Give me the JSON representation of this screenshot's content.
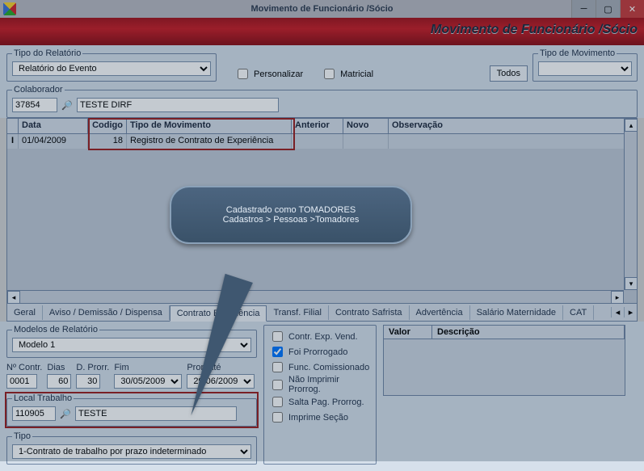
{
  "window": {
    "title": "Movimento de Funcionário /Sócio",
    "subtitle": "Movimento de Funcionário /Sócio"
  },
  "filters": {
    "tipo_relatorio_label": "Tipo do Relatório",
    "tipo_relatorio_value": "Relatório do Evento",
    "personalizar_label": "Personalizar",
    "matricial_label": "Matricial",
    "todos_label": "Todos",
    "tipo_movimento_label": "Tipo de Movimento",
    "tipo_movimento_value": ""
  },
  "colab": {
    "label": "Colaborador",
    "code": "37854",
    "name": "TESTE DIRF"
  },
  "grid": {
    "headers": {
      "data": "Data",
      "codigo": "Codigo",
      "tipomov": "Tipo de Movimento",
      "anterior": "Anterior",
      "novo": "Novo",
      "obs": "Observação"
    },
    "row0": {
      "data": "01/04/2009",
      "codigo": "18",
      "tipomov": "Registro de Contrato de Experiência",
      "anterior": "",
      "novo": "",
      "obs": ""
    }
  },
  "callout": {
    "line1": "Cadastrado  como TOMADORES",
    "line2": "Cadastros > Pessoas >Tomadores"
  },
  "tabs": {
    "geral": "Geral",
    "aviso": "Aviso / Demissão / Dispensa",
    "contrato": "Contrato Experiência",
    "transf": "Transf. Filial",
    "safrista": "Contrato Safrista",
    "advert": "Advertência",
    "salmat": "Salário Maternidade",
    "cat": "CAT"
  },
  "contrato": {
    "modelos_label": "Modelos de Relatório",
    "modelo_value": "Modelo 1",
    "n_contr_label": "Nº Contr.",
    "n_contr_value": "0001",
    "dias_label": "Dias",
    "dias_value": "60",
    "dprorr_label": "D. Prorr.",
    "dprorr_value": "30",
    "fim_label": "Fim",
    "fim_value": "30/05/2009",
    "prorate_label": "Pror. Até",
    "prorate_value": "29/06/2009",
    "local_label": "Local Trabalho",
    "local_code": "110905",
    "local_name": "TESTE",
    "tipo_label": "Tipo",
    "tipo_value": "1-Contrato de trabalho por prazo indeterminado"
  },
  "checks": {
    "c1": "Contr. Exp. Vend.",
    "c2": "Foi Prorrogado",
    "c3": "Func. Comissionado",
    "c4": "Não Imprimir Prorrog.",
    "c5": "Salta Pag. Prorrog.",
    "c6": "Imprime Seção"
  },
  "valgrid": {
    "valor": "Valor",
    "descricao": "Descrição"
  }
}
